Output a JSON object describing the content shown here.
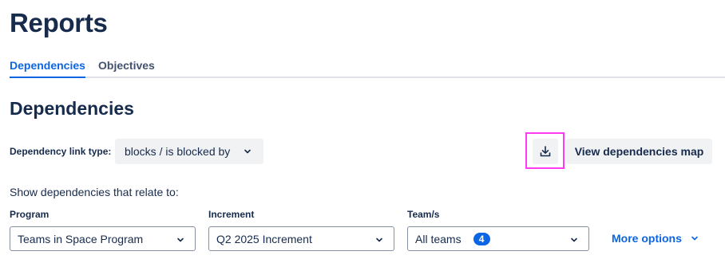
{
  "page": {
    "title": "Reports"
  },
  "tabs": [
    {
      "label": "Dependencies",
      "active": true
    },
    {
      "label": "Objectives",
      "active": false
    }
  ],
  "section": {
    "title": "Dependencies"
  },
  "link_type": {
    "label": "Dependency link type:",
    "value": "blocks / is blocked by"
  },
  "toolbar": {
    "download_icon": "download-icon",
    "map_button_label": "View dependencies map"
  },
  "filters": {
    "intro": "Show dependencies that relate to:",
    "program": {
      "label": "Program",
      "value": "Teams in Space Program"
    },
    "increment": {
      "label": "Increment",
      "value": "Q2 2025 Increment"
    },
    "teams": {
      "label": "Team/s",
      "value": "All teams",
      "count": "4"
    },
    "more_options": "More options"
  },
  "colors": {
    "accent": "#0c66e4",
    "text": "#172b4d",
    "button_bg": "#f1f2f4",
    "highlight": "#ff3bf0"
  }
}
